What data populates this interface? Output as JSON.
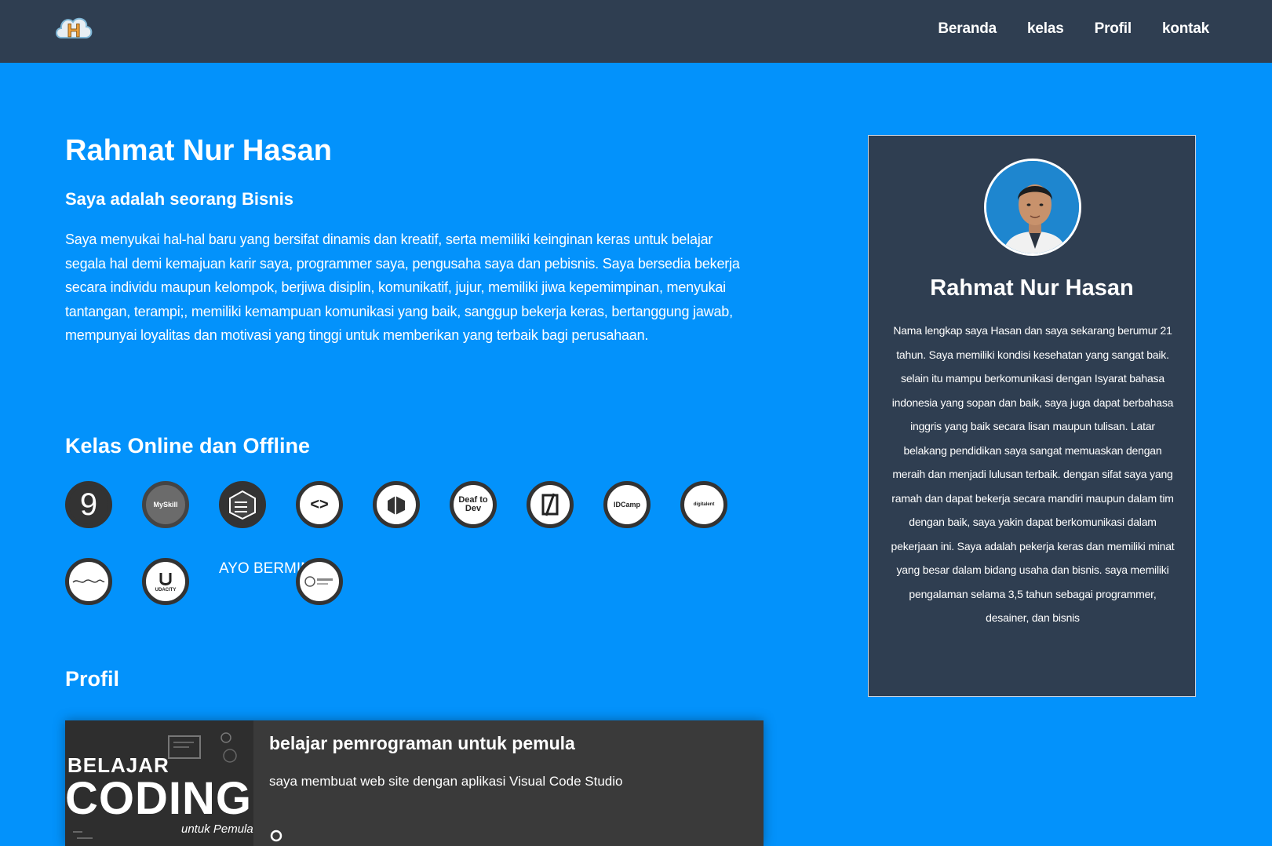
{
  "nav": {
    "logo_letter": "H",
    "items": [
      "Beranda",
      "kelas",
      "Profil",
      "kontak"
    ]
  },
  "hero": {
    "name": "Rahmat Nur Hasan",
    "subtitle": "Saya adalah seorang Bisnis",
    "description": "Saya menyukai hal-hal baru yang bersifat dinamis dan kreatif, serta memiliki keinginan keras untuk belajar segala hal demi kemajuan karir saya, programmer saya, pengusaha saya dan pebisnis. Saya bersedia bekerja secara individu maupun kelompok, berjiwa disiplin, komunikatif, jujur, memiliki jiwa kepemimpinan, menyukai tantangan, terampi;, memiliki kemampuan komunikasi yang baik, sanggup bekerja keras, bertanggung jawab, mempunyai loyalitas dan motivasi yang tinggi untuk memberikan yang terbaik bagi perusahaan."
  },
  "classes": {
    "title": "Kelas Online dan Offline",
    "items": [
      {
        "label": "9",
        "icon": "skill-academy-logo"
      },
      {
        "label": "MySkill",
        "icon": "myskill-logo"
      },
      {
        "label": "",
        "icon": "cube-logo"
      },
      {
        "label": "<>",
        "icon": "code-brackets-logo"
      },
      {
        "label": "",
        "icon": "blocks-logo"
      },
      {
        "label": "Deaf to Dev",
        "icon": "deaf-to-dev-logo"
      },
      {
        "label": "",
        "icon": "square-slash-logo"
      },
      {
        "label": "IDCamp",
        "icon": "idcamp-logo"
      },
      {
        "label": "digitalent",
        "icon": "digitalent-logo"
      },
      {
        "label": "",
        "icon": "script-logo"
      },
      {
        "label": "UDACITY",
        "icon": "udacity-logo"
      },
      {
        "label": "AYO BERMIMPI",
        "icon": "broken-image-icon"
      },
      {
        "label": "",
        "icon": "bootcamp-logo"
      }
    ]
  },
  "profile": {
    "title": "Profil",
    "card": {
      "thumb_line1": "BELAJAR",
      "thumb_line2": "CODING",
      "thumb_line3": "untuk Pemula",
      "title": "belajar pemrograman untuk pemula",
      "description": "saya membuat web site dengan aplikasi Visual Code Studio"
    }
  },
  "sidebar": {
    "name": "Rahmat Nur Hasan",
    "bio": "Nama lengkap saya Hasan dan saya sekarang berumur 21 tahun. Saya memiliki kondisi kesehatan yang sangat baik. selain itu mampu berkomunikasi dengan Isyarat bahasa indonesia yang sopan dan baik, saya juga dapat berbahasa inggris yang baik secara lisan maupun tulisan. Latar belakang pendidikan saya sangat memuaskan dengan meraih dan menjadi lulusan terbaik. dengan sifat saya yang ramah dan dapat bekerja secara mandiri maupun dalam tim dengan baik, saya yakin dapat berkomunikasi dalam pekerjaan ini. Saya adalah pekerja keras dan memiliki minat yang besar dalam bidang usaha dan bisnis. saya memiliki pengalaman selama 3,5 tahun sebagai programmer, desainer, dan bisnis"
  },
  "colors": {
    "background": "#0392fb",
    "navbar": "#2f3e51",
    "card": "#3a3a3a",
    "text": "#ffffff"
  }
}
